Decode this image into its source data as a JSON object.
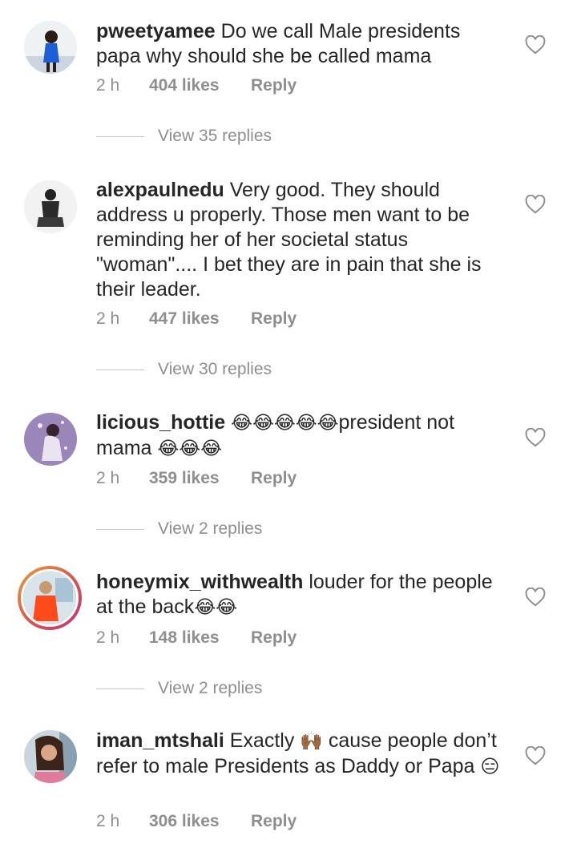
{
  "comments": [
    {
      "username": "pweetyamee",
      "text": "Do we call Male presidents papa why should she be called mama",
      "time": "2 h",
      "likes": "404 likes",
      "reply": "Reply",
      "view_replies": "View 35 replies",
      "avatar_icon": "user-avatar"
    },
    {
      "username": "alexpaulnedu",
      "text": "Very good. They should address u properly. Those men want to be reminding her of her societal status \"woman\".... I bet they are in pain that she is their leader.",
      "time": "2 h",
      "likes": "447 likes",
      "reply": "Reply",
      "view_replies": "View 30 replies",
      "avatar_icon": "user-avatar"
    },
    {
      "username": "licious_hottie",
      "text_before": "",
      "emojis_a": "😂😂😂😂😂",
      "text_middle": "president not mama ",
      "emojis_b": "😂😂😂",
      "time": "2 h",
      "likes": "359 likes",
      "reply": "Reply",
      "view_replies": "View 2 replies",
      "avatar_icon": "user-avatar"
    },
    {
      "username": "honeymix_withwealth",
      "text": "louder for the people at the back",
      "emojis": "😂😂",
      "time": "2 h",
      "likes": "148 likes",
      "reply": "Reply",
      "view_replies": "View 2 replies",
      "avatar_icon": "user-avatar-story-ring"
    },
    {
      "username": "iman_mtshali",
      "text_a": "Exactly",
      "emoji_a": "🙌🏾",
      "text_b": "cause people don’t refer to male Presidents as Daddy or Papa",
      "emoji_b": "😑",
      "time": "2 h",
      "likes": "306 likes",
      "reply": "Reply",
      "avatar_icon": "user-avatar"
    }
  ],
  "icons": {
    "like": "heart-outline-icon"
  },
  "colors": {
    "text": "#262626",
    "secondary": "#8e8e8e",
    "divider": "#c7c7c7"
  }
}
